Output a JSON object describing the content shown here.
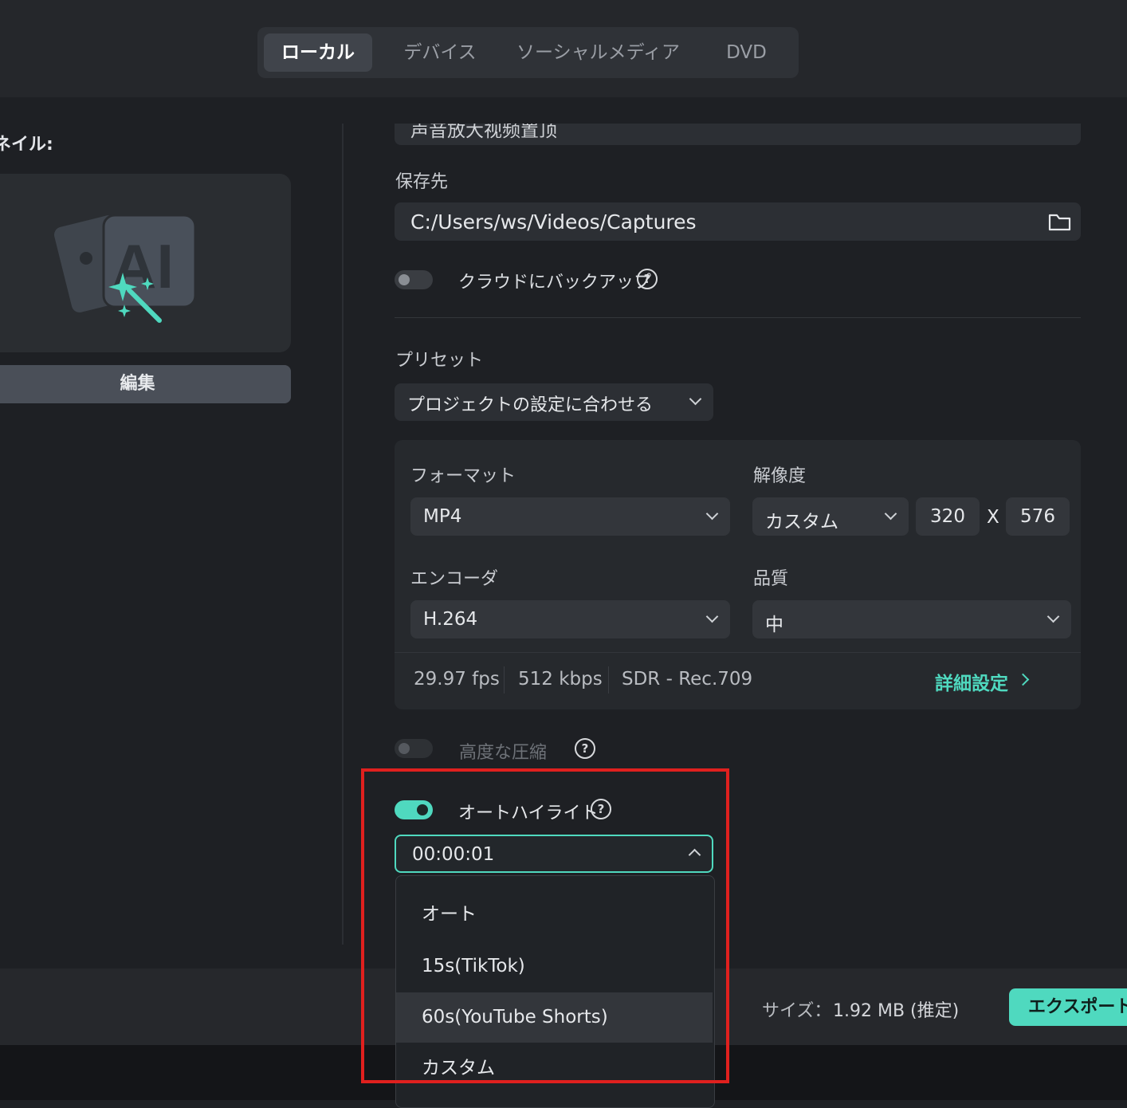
{
  "tabs": {
    "items": [
      {
        "label": "ローカル",
        "active": true
      },
      {
        "label": "デバイス",
        "active": false
      },
      {
        "label": "ソーシャルメディア",
        "active": false
      },
      {
        "label": "DVD",
        "active": false
      }
    ]
  },
  "left": {
    "thumbnail_label": "ネイル:",
    "thumbnail_text": "AI",
    "edit_button": "編集"
  },
  "form": {
    "name_value": "声音放大视频置顶",
    "save_to_label": "保存先",
    "save_path": "C:/Users/ws/Videos/Captures",
    "cloud_backup_label": "クラウドにバックアップ",
    "help_glyph": "?",
    "preset_label": "プリセット",
    "preset_value": "プロジェクトの設定に合わせる",
    "format_label": "フォーマット",
    "format_value": "MP4",
    "resolution_label": "解像度",
    "resolution_value": "カスタム",
    "width": "320",
    "x_sep": "X",
    "height": "576",
    "encoder_label": "エンコーダ",
    "encoder_value": "H.264",
    "quality_label": "品質",
    "quality_value": "中",
    "fps": "29.97 fps",
    "bitrate": "512 kbps",
    "color": "SDR - Rec.709",
    "advanced_link": "詳細設定",
    "advanced_compress_label": "高度な圧縮",
    "auto_highlight_label": "オートハイライト",
    "duration_value": "00:00:01",
    "duration_options": [
      "オート",
      "15s(TikTok)",
      "60s(YouTube Shorts)",
      "カスタム"
    ],
    "highlighted_option": "60s(YouTube Shorts)"
  },
  "footer": {
    "size_label": "サイズ：",
    "size_value": "1.92 MB (推定)",
    "export_button": "エクスポート"
  },
  "colors": {
    "accent": "#4fd9bf",
    "annotation_red": "#e0201e",
    "background": "#1e2024"
  }
}
